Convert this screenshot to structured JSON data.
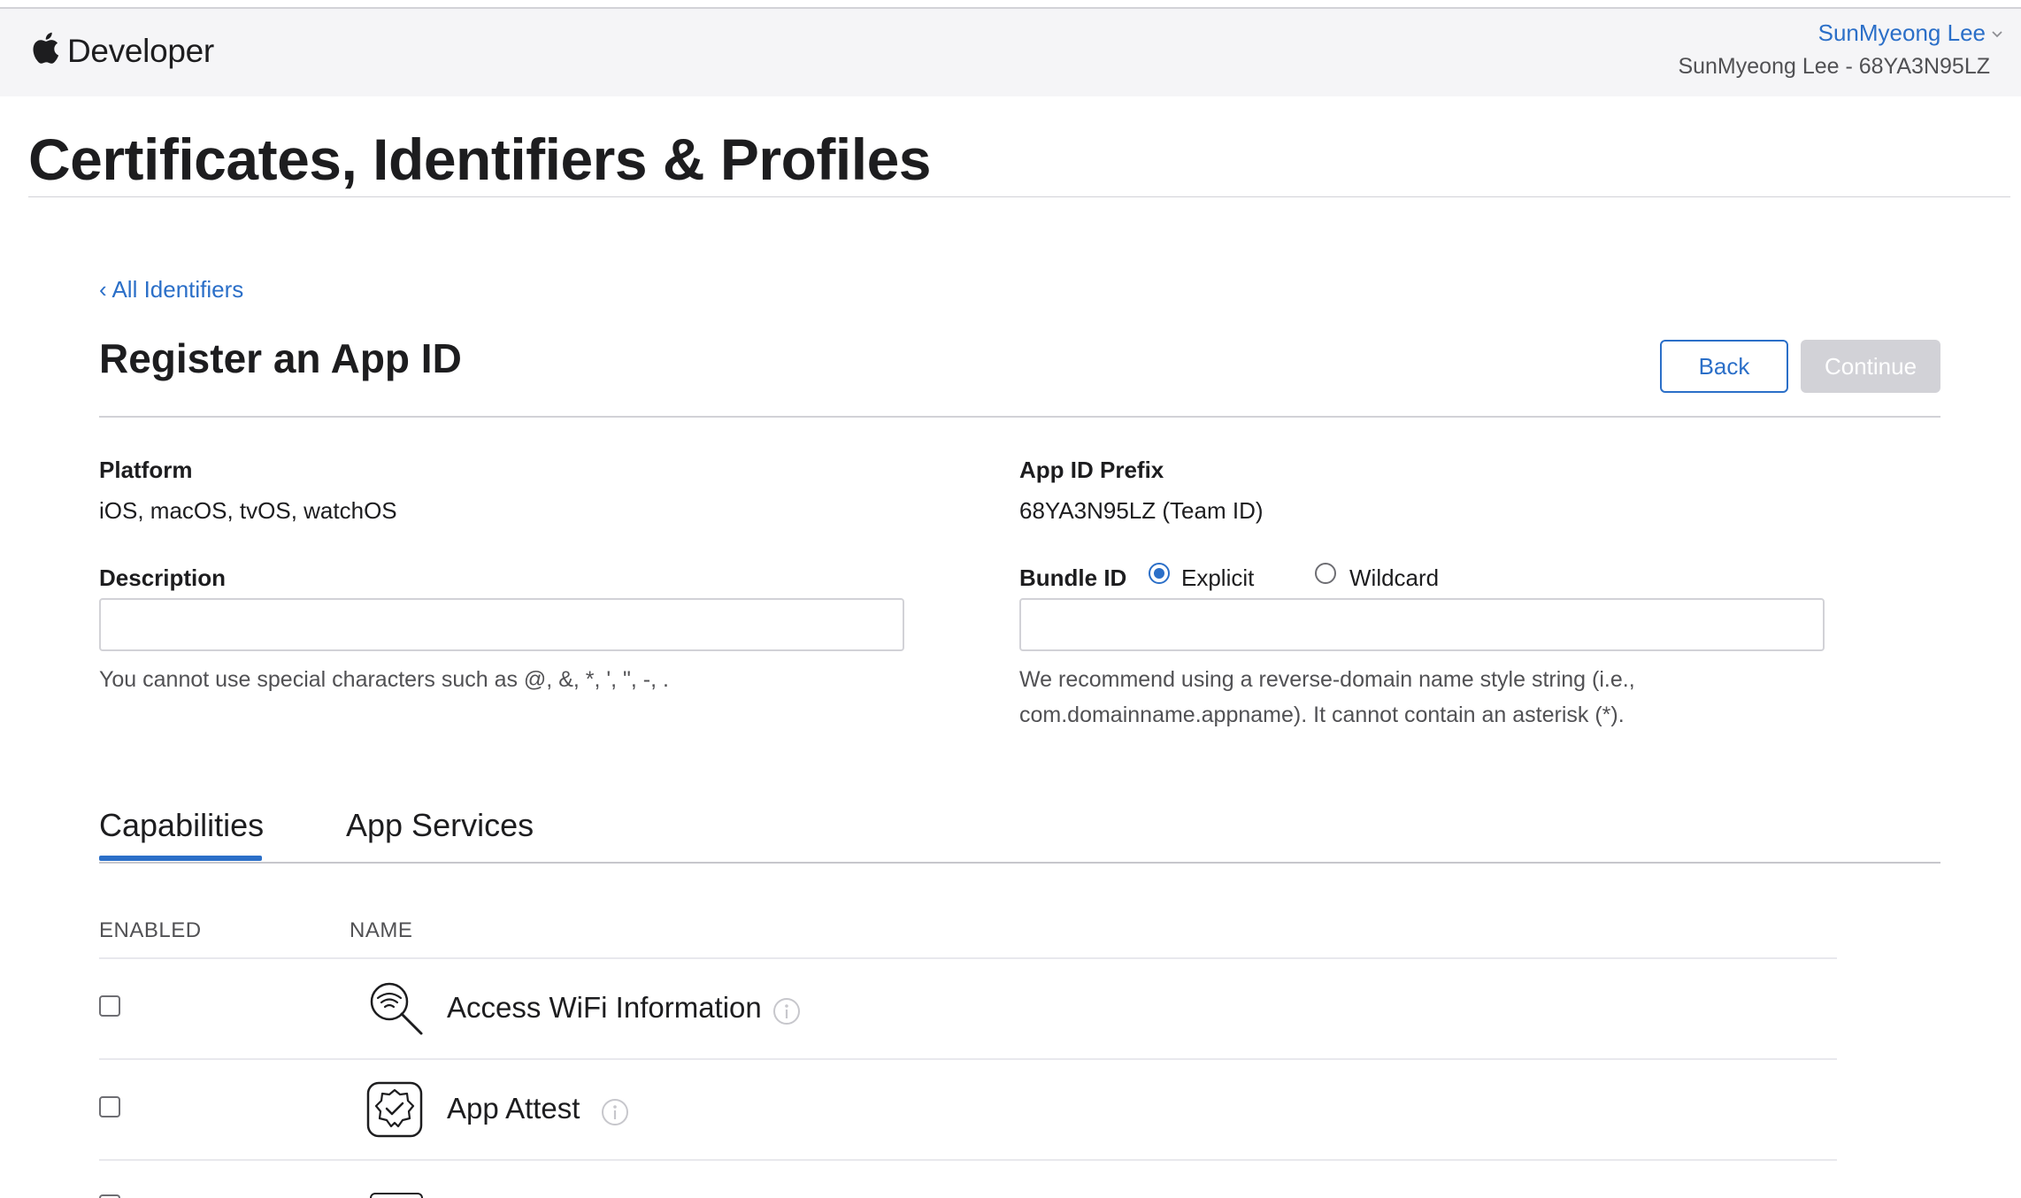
{
  "header": {
    "brand": "Developer",
    "user_name": "SunMyeong Lee",
    "team_line": "SunMyeong Lee - 68YA3N95LZ",
    "icons": {
      "logo": "apple-logo-icon",
      "menu": "chevron-down-icon"
    }
  },
  "page": {
    "title": "Certificates, Identifiers & Profiles"
  },
  "form": {
    "back_link": "‹ All Identifiers",
    "title": "Register an App ID",
    "back_button": "Back",
    "continue_button": "Continue",
    "platform_label": "Platform",
    "platform_value": "iOS, macOS, tvOS, watchOS",
    "prefix_label": "App ID Prefix",
    "prefix_value": "68YA3N95LZ (Team ID)",
    "description_label": "Description",
    "description_value": "",
    "description_hint": "You cannot use special characters such as @, &, *, ', \", -, .",
    "bundle_label": "Bundle ID",
    "bundle_options": [
      "Explicit",
      "Wildcard"
    ],
    "bundle_selected": "Explicit",
    "bundle_value": "",
    "bundle_hint_line1": "We recommend using a reverse-domain name style string (i.e.,",
    "bundle_hint_line2": "com.domainname.appname). It cannot contain an asterisk (*)."
  },
  "tabs": [
    {
      "label": "Capabilities",
      "active": true
    },
    {
      "label": "App Services",
      "active": false
    }
  ],
  "table": {
    "col_enabled": "ENABLED",
    "col_name": "NAME",
    "rows": [
      {
        "name": "Access WiFi Information",
        "enabled": false,
        "icon": "wifi-search-icon"
      },
      {
        "name": "App Attest",
        "enabled": false,
        "icon": "verified-badge-icon"
      }
    ]
  },
  "colors": {
    "accent": "#2b6fc8",
    "header_bg": "#f5f5f7",
    "disabled_button": "#d2d2d7"
  }
}
